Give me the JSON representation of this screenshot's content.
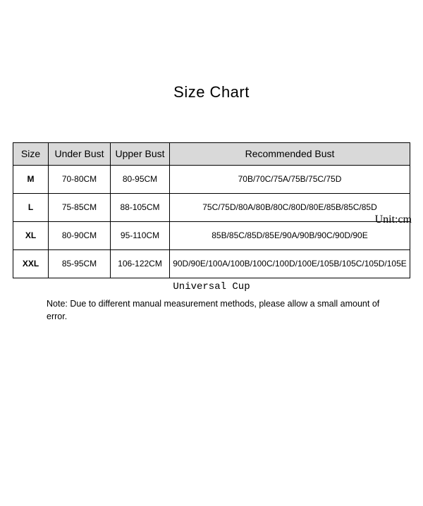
{
  "title": "Size  Chart",
  "unit": "Unit:cm",
  "headers": {
    "size": "Size",
    "under": "Under Bust",
    "upper": "Upper Bust",
    "rec": "Recommended Bust"
  },
  "rows": [
    {
      "size": "M",
      "under": "70-80CM",
      "upper": "80-95CM",
      "rec": "70B/70C/75A/75B/75C/75D"
    },
    {
      "size": "L",
      "under": "75-85CM",
      "upper": "88-105CM",
      "rec": "75C/75D/80A/80B/80C/80D/80E/85B/85C/85D"
    },
    {
      "size": "XL",
      "under": "80-90CM",
      "upper": "95-110CM",
      "rec": "85B/85C/85D/85E/90A/90B/90C/90D/90E"
    },
    {
      "size": "XXL",
      "under": "85-95CM",
      "upper": "106-122CM",
      "rec": "90D/90E/100A/100B/100C/100D/100E/105B/105C/105D/105E"
    }
  ],
  "caption": "Universal Cup",
  "note": "Note: Due to different manual measurement methods, please allow a small amount of error.",
  "chart_data": {
    "type": "table",
    "title": "Size Chart",
    "unit": "cm",
    "columns": [
      "Size",
      "Under Bust",
      "Upper Bust",
      "Recommended Bust"
    ],
    "data": [
      [
        "M",
        "70-80CM",
        "80-95CM",
        "70B/70C/75A/75B/75C/75D"
      ],
      [
        "L",
        "75-85CM",
        "88-105CM",
        "75C/75D/80A/80B/80C/80D/80E/85B/85C/85D"
      ],
      [
        "XL",
        "80-90CM",
        "95-110CM",
        "85B/85C/85D/85E/90A/90B/90C/90D/90E"
      ],
      [
        "XXL",
        "85-95CM",
        "106-122CM",
        "90D/90E/100A/100B/100C/100D/100E/105B/105C/105D/105E"
      ]
    ]
  }
}
